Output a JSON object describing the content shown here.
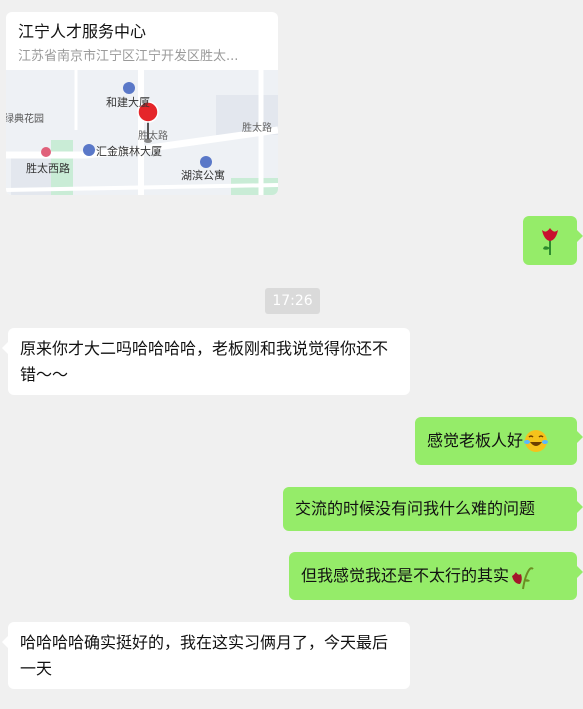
{
  "location_card": {
    "title": "江宁人才服务中心",
    "address": "江苏省南京市江宁区江宁开发区胜太...",
    "map_labels": {
      "poi_1": "和建大厦",
      "poi_2": "汇金旗林大厦",
      "poi_3": "湖滨公寓",
      "road_1": "胜太路",
      "road_2": "胜太路",
      "road_3": "胜太西路",
      "park": "绿典花园"
    }
  },
  "timestamp": "17:26",
  "messages": [
    {
      "side": "right",
      "emoji": "rose-icon",
      "text": ""
    },
    {
      "side": "left",
      "text": "原来你才大二吗哈哈哈哈，老板刚和我说觉得你还不错～～"
    },
    {
      "side": "right",
      "text": "感觉老板人好",
      "emoji": "laugh-icon"
    },
    {
      "side": "right",
      "text": "交流的时候没有问我什么难的问题"
    },
    {
      "side": "right",
      "text": "但我感觉我还是不太行的其实",
      "emoji": "wilted-rose-icon"
    },
    {
      "side": "left",
      "text": "哈哈哈哈确实挺好的，我在这实习俩月了，今天最后一天"
    }
  ],
  "colors": {
    "background": "#f0f0f0",
    "self_bubble": "#95ec69",
    "other_bubble": "#ffffff",
    "pin": "#e5262a"
  }
}
